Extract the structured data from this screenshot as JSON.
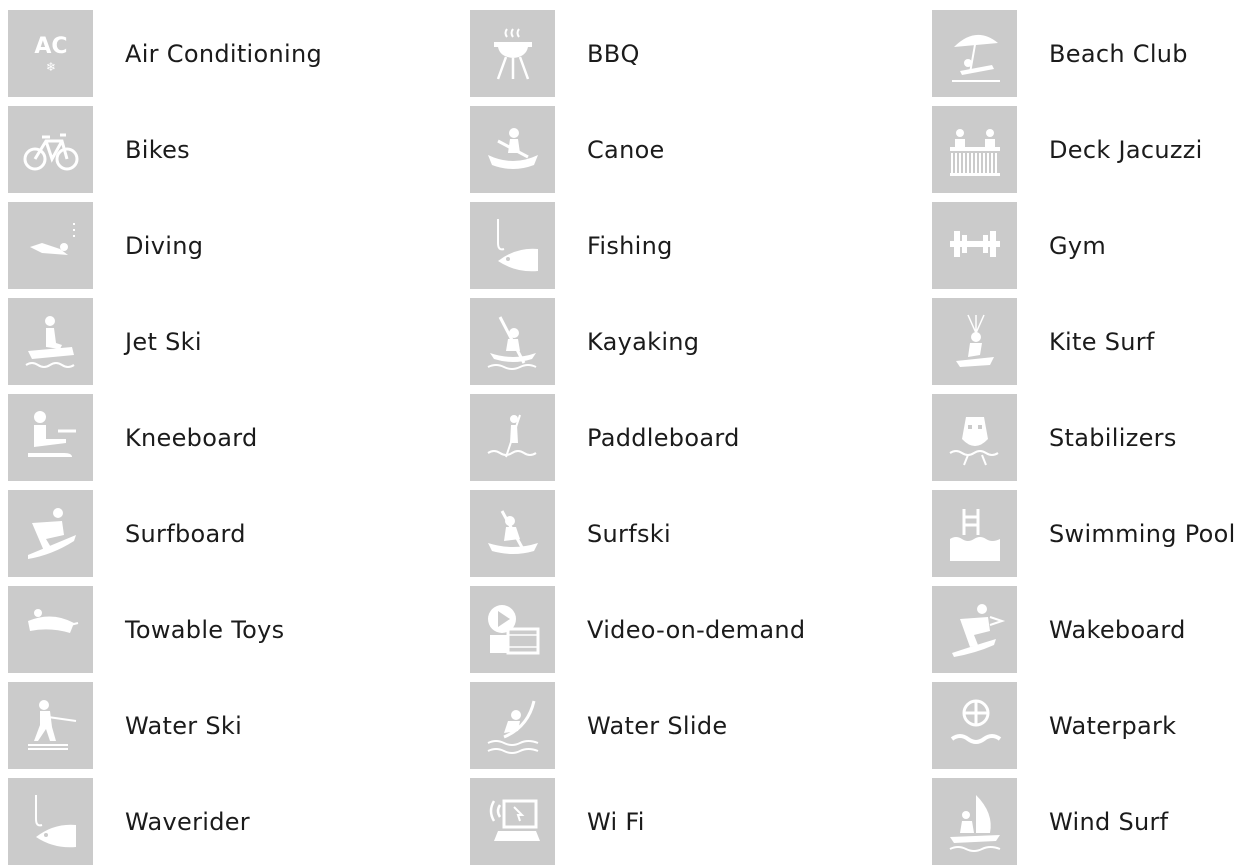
{
  "amenities": [
    {
      "label": "Air Conditioning",
      "icon": "air-conditioning-icon"
    },
    {
      "label": "BBQ",
      "icon": "bbq-icon"
    },
    {
      "label": "Beach Club",
      "icon": "beach-club-icon"
    },
    {
      "label": "Bikes",
      "icon": "bike-icon"
    },
    {
      "label": "Canoe",
      "icon": "canoe-icon"
    },
    {
      "label": "Deck Jacuzzi",
      "icon": "deck-jacuzzi-icon"
    },
    {
      "label": "Diving",
      "icon": "diving-icon"
    },
    {
      "label": "Fishing",
      "icon": "fishing-icon"
    },
    {
      "label": "Gym",
      "icon": "gym-icon"
    },
    {
      "label": "Jet Ski",
      "icon": "jet-ski-icon"
    },
    {
      "label": "Kayaking",
      "icon": "kayaking-icon"
    },
    {
      "label": "Kite Surf",
      "icon": "kite-surf-icon"
    },
    {
      "label": "Kneeboard",
      "icon": "kneeboard-icon"
    },
    {
      "label": "Paddleboard",
      "icon": "paddleboard-icon"
    },
    {
      "label": "Stabilizers",
      "icon": "stabilizers-icon"
    },
    {
      "label": "Surfboard",
      "icon": "surfboard-icon"
    },
    {
      "label": "Surfski",
      "icon": "surfski-icon"
    },
    {
      "label": "Swimming Pool",
      "icon": "swimming-pool-icon"
    },
    {
      "label": "Towable Toys",
      "icon": "towable-toys-icon"
    },
    {
      "label": "Video-on-demand",
      "icon": "video-on-demand-icon"
    },
    {
      "label": "Wakeboard",
      "icon": "wakeboard-icon"
    },
    {
      "label": "Water Ski",
      "icon": "water-ski-icon"
    },
    {
      "label": "Water Slide",
      "icon": "water-slide-icon"
    },
    {
      "label": "Waterpark",
      "icon": "waterpark-icon"
    },
    {
      "label": "Waverider",
      "icon": "waverider-icon"
    },
    {
      "label": "Wi Fi",
      "icon": "wifi-icon"
    },
    {
      "label": "Wind Surf",
      "icon": "wind-surf-icon"
    }
  ],
  "colors": {
    "tile": "#cbcbcb",
    "icon": "#ffffff",
    "text": "#1b1b1b"
  }
}
